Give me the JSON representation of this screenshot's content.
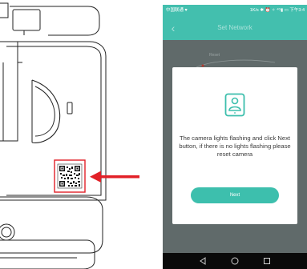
{
  "status_bar": {
    "carrier": "中国联通 ♥",
    "right_status": "1K/s ✱ ⏰ ✧ ⁴ᴳ▮ ▭ 下午3:4"
  },
  "app_header": {
    "title": "Set Network"
  },
  "background_label": "Reset",
  "dialog": {
    "message": "The camera lights flashing and click Next button, if there is no lights flashing please reset camera",
    "next_label": "Next"
  },
  "icons": {
    "back": "back-chevron-icon",
    "camera": "camera-device-icon",
    "nav_back": "triangle-back-icon",
    "nav_home": "circle-home-icon",
    "nav_recent": "square-recent-icon",
    "arrow": "red-arrow-icon",
    "qr": "qr-code-icon"
  },
  "colors": {
    "accent": "#43bfae",
    "button": "#3dbfad",
    "arrow": "#e22027"
  }
}
